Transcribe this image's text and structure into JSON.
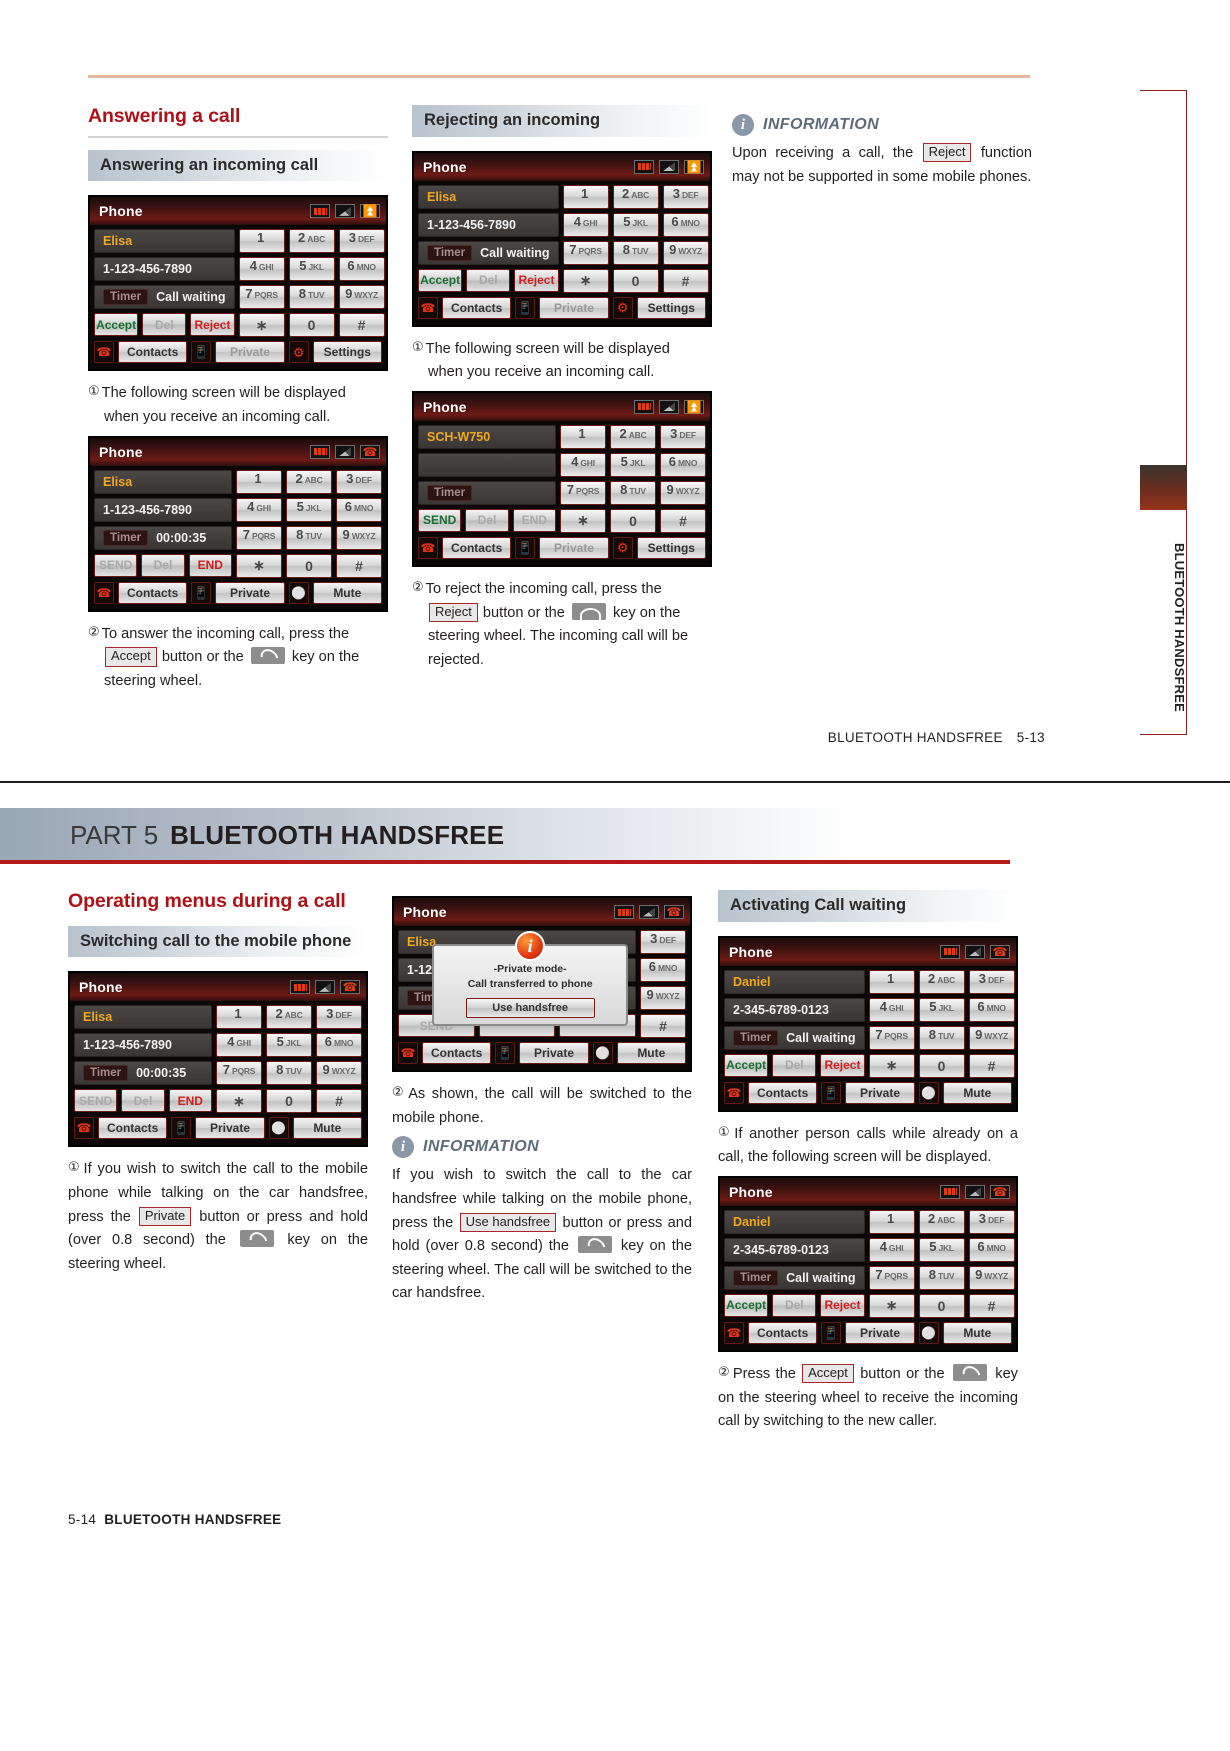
{
  "page1": {
    "footer": {
      "label": "BLUETOOTH HANDSFREE",
      "page": "5-13"
    },
    "side_tab": "BLUETOOTH HANDSFREE",
    "col1": {
      "title": "Answering a call",
      "subhead": "Answering an incoming call",
      "step1_prefix": "①",
      "step1": "The following screen will be displayed",
      "step1_cont": "when you receive an incoming call.",
      "step2_prefix": "②",
      "step2_a": "To answer the incoming call, press the",
      "step2_key": "Accept",
      "step2_b": "button or the",
      "step2_c": "key on the",
      "step2_d": "steering wheel.",
      "screen1": {
        "title": "Phone",
        "status_icons": [
          "battery-icon",
          "signal-icon",
          "bluetooth-icon"
        ],
        "field_name": "Elisa",
        "field_number": "1-123-456-7890",
        "timer_label": "Timer",
        "timer_value": "Call waiting",
        "buttons": [
          "Accept",
          "Del",
          "Reject"
        ],
        "keys": [
          {
            "d": "1",
            "s": ""
          },
          {
            "d": "2",
            "s": "ABC"
          },
          {
            "d": "3",
            "s": "DEF"
          },
          {
            "d": "4",
            "s": "GHI"
          },
          {
            "d": "5",
            "s": "JKL"
          },
          {
            "d": "6",
            "s": "MNO"
          },
          {
            "d": "7",
            "s": "PQRS"
          },
          {
            "d": "8",
            "s": "TUV"
          },
          {
            "d": "9",
            "s": "WXYZ"
          },
          {
            "d": "∗",
            "s": ""
          },
          {
            "d": "0",
            "s": ""
          },
          {
            "d": "#",
            "s": ""
          }
        ],
        "bar": [
          "Contacts",
          "Private",
          "Settings"
        ]
      },
      "screen2": {
        "title": "Phone",
        "status_icons": [
          "battery-icon",
          "signal-icon",
          "call-icon"
        ],
        "field_name": "Elisa",
        "field_number": "1-123-456-7890",
        "timer_label": "Timer",
        "timer_value": "00:00:35",
        "buttons": [
          "SEND",
          "Del",
          "END"
        ],
        "bar": [
          "Contacts",
          "Private",
          "Mute"
        ]
      }
    },
    "col2": {
      "subhead": "Rejecting an incoming",
      "step1_prefix": "①",
      "step1": "The following screen will be displayed",
      "step1_cont": "when you receive an incoming call.",
      "step2_prefix": "②",
      "step2_a": "To reject the incoming call, press the",
      "step2_key": "Reject",
      "step2_b": "button or the",
      "step2_c": "key on the",
      "step2_d": "steering wheel.  The incoming call will be",
      "step2_e": "rejected.",
      "screen1": {
        "title": "Phone",
        "field_name": "Elisa",
        "field_number": "1-123-456-7890",
        "timer_label": "Timer",
        "timer_value": "Call waiting",
        "buttons": [
          "Accept",
          "Del",
          "Reject"
        ],
        "bar": [
          "Contacts",
          "Private",
          "Settings"
        ]
      },
      "screen2": {
        "title": "Phone",
        "field_name": "SCH-W750",
        "field_number": "",
        "timer_label": "Timer",
        "timer_value": "",
        "buttons": [
          "SEND",
          "Del",
          "END"
        ],
        "bar": [
          "Contacts",
          "Private",
          "Settings"
        ]
      }
    },
    "col3": {
      "info_title": "INFORMATION",
      "info_a": "Upon receiving a call, the",
      "info_key": "Reject",
      "info_b": "function may not be supported in some mobile phones."
    }
  },
  "page2": {
    "part_number": "PART 5",
    "part_title": "BLUETOOTH HANDSFREE",
    "footer": {
      "page": "5-14",
      "label": "BLUETOOTH HANDSFREE"
    },
    "col1": {
      "title": "Operating menus during a call",
      "subhead": "Switching call to the mobile phone",
      "step1_prefix": "①",
      "step1_a": "If you wish to switch the call to the mobile phone while talking on the car handsfree, press the",
      "step1_key": "Private",
      "step1_b": "button or press and hold (over 0.8 second) the",
      "step1_c": "key on the steering wheel.",
      "screen1": {
        "title": "Phone",
        "field_name": "Elisa",
        "field_number": "1-123-456-7890",
        "timer_label": "Timer",
        "timer_value": "00:00:35",
        "buttons": [
          "SEND",
          "Del",
          "END"
        ],
        "bar": [
          "Contacts",
          "Private",
          "Mute"
        ]
      }
    },
    "col2": {
      "step2_prefix": "②",
      "step2": "As shown, the call will be switched to the mobile phone.",
      "info_title": "INFORMATION",
      "info_a": "If you wish to switch the call to the car handsfree while talking on the mobile phone, press the",
      "info_key": "Use handsfree",
      "info_b": "button or press and hold (over 0.8 second) the",
      "info_c": "key on the steering wheel. The call will be switched to the car handsfree.",
      "screen1": {
        "title": "Phone",
        "field_name": "Elisa",
        "field_number": "1-123-4",
        "timer_label": "Timer",
        "timer_value": "",
        "buttons": [
          "SEND",
          "",
          ""
        ],
        "bar": [
          "Contacts",
          "Private",
          "Mute"
        ],
        "modal": {
          "line1": "-Private mode-",
          "line2": "Call transferred to phone",
          "button": "Use handsfree"
        },
        "visible_keys": [
          "3 DEF",
          "6 MNO",
          "9 WXYZ",
          "#"
        ]
      }
    },
    "col3": {
      "subhead": "Activating Call waiting",
      "step1_prefix": "①",
      "step1": "If another person calls while already on a call, the following screen will be displayed.",
      "step2_prefix": "②",
      "step2_a": "Press the",
      "step2_key": "Accept",
      "step2_b": "button or the",
      "step2_c": "key on the steering wheel to receive the incoming call by switching to the new caller.",
      "screen1": {
        "title": "Phone",
        "field_name": "Daniel",
        "field_number": "2-345-6789-0123",
        "timer_label": "Timer",
        "timer_value": "Call waiting",
        "buttons": [
          "Accept",
          "Del",
          "Reject"
        ],
        "bar": [
          "Contacts",
          "Private",
          "Mute"
        ]
      },
      "screen2": {
        "title": "Phone",
        "field_name": "Daniel",
        "field_number": "2-345-6789-0123",
        "timer_label": "Timer",
        "timer_value": "Call waiting",
        "buttons": [
          "Accept",
          "Del",
          "Reject"
        ],
        "bar": [
          "Contacts",
          "Private",
          "Mute"
        ]
      }
    }
  },
  "keypad": {
    "rows": [
      [
        {
          "d": "1",
          "s": ""
        },
        {
          "d": "2",
          "s": "ABC"
        },
        {
          "d": "3",
          "s": "DEF"
        }
      ],
      [
        {
          "d": "4",
          "s": "GHI"
        },
        {
          "d": "5",
          "s": "JKL"
        },
        {
          "d": "6",
          "s": "MNO"
        }
      ],
      [
        {
          "d": "7",
          "s": "PQRS"
        },
        {
          "d": "8",
          "s": "TUV"
        },
        {
          "d": "9",
          "s": "WXYZ"
        }
      ],
      [
        {
          "d": "∗",
          "s": ""
        },
        {
          "d": "0",
          "s": ""
        },
        {
          "d": "#",
          "s": ""
        }
      ]
    ]
  },
  "colors": {
    "heading_red": "#b01116",
    "rule_red": "#b51b1b",
    "info_blue": "#5d6b7a",
    "top_rule": "#e5b79b"
  }
}
